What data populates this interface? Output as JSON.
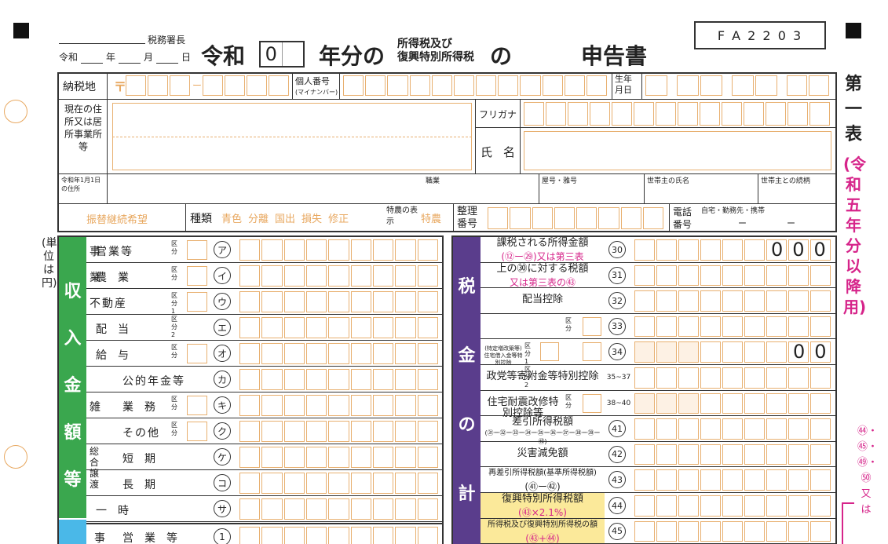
{
  "header": {
    "tax_office": "税務署長",
    "date_line": [
      "令和",
      "年",
      "月",
      "日"
    ],
    "title_reiwa": "令和",
    "year_value": "0",
    "year_suffix": "年分の",
    "tax_line1": "所得税及び",
    "tax_line2": "復興特別所得税",
    "no": "の",
    "title": "申告書",
    "form_code": "F A 2 2 0 3"
  },
  "side": {
    "table_no": "第一表",
    "period": "(令和五年分以降用)",
    "unit": "(単位は円)",
    "right_refs": "㊹・㊺・㊾・㊿又は"
  },
  "info": {
    "address_label": "納税地",
    "postal_mark": "〒",
    "mynumber_label": "個人番号",
    "mynumber_sub": "(マイナンバー)",
    "birth_label": "生年月日",
    "current_address_label": "現在の住所又は居所事業所等",
    "furigana_label": "フリガナ",
    "name_label": "氏名",
    "jan1_label": "令和年1月1日の住所",
    "occupation_label": "職業",
    "trade_name_label": "屋号・雅号",
    "householder_label": "世帯主の氏名",
    "householder_rel_label": "世帯主との続柄",
    "transfer_label": "振替継続希望",
    "type_label": "種類",
    "types": [
      "青色",
      "分離",
      "国出",
      "損失",
      "修正"
    ],
    "special_label": "特農の表示",
    "special_value": "特農",
    "ref_no_label": "整理番号",
    "phone_label": "電話番号",
    "phone_sub": "自宅・勤務先・携帯",
    "phone_dashes": [
      "ー",
      "ー"
    ]
  },
  "income": {
    "band_label": "収入金額等",
    "rows": [
      {
        "cat": "事",
        "item": "営業等",
        "kubun": "区分",
        "mark": "ア"
      },
      {
        "cat": "業",
        "item": "農業",
        "kubun": "区分",
        "mark": "イ"
      },
      {
        "cat": "",
        "item": "不動産",
        "kubun": "区分1 区分2",
        "mark": "ウ"
      },
      {
        "cat": "",
        "item": "配当",
        "kubun": "",
        "mark": "エ"
      },
      {
        "cat": "",
        "item": "給与",
        "kubun": "区分",
        "mark": "オ"
      },
      {
        "cat": "",
        "item": "公的年金等",
        "kubun": "",
        "mark": "カ"
      },
      {
        "cat": "雑",
        "item": "業務",
        "kubun": "区分",
        "mark": "キ"
      },
      {
        "cat": "",
        "item": "その他",
        "kubun": "区分",
        "mark": "ク"
      },
      {
        "cat": "総合譲渡",
        "item": "短期",
        "kubun": "",
        "mark": "ケ"
      },
      {
        "cat": "",
        "item": "長期",
        "kubun": "",
        "mark": "コ"
      },
      {
        "cat": "",
        "item": "一時",
        "kubun": "",
        "mark": "サ"
      }
    ],
    "bottom_row": {
      "cat": "事",
      "item": "営業等",
      "mark": "1"
    }
  },
  "tax": {
    "band_label": "税金の計",
    "rows": [
      {
        "l1": "課税される所得金額",
        "l2": "(⑫ー㉙)又は第三表",
        "mark": "30",
        "value": "000"
      },
      {
        "l1": "上の㉚に対する税額",
        "l2": "又は第三表の㊸",
        "mark": "31",
        "value": ""
      },
      {
        "l1": "配当控除",
        "l2": "",
        "mark": "32",
        "value": ""
      },
      {
        "l1": "",
        "l2": "区分",
        "mark": "33",
        "value": ""
      },
      {
        "l1": "(特定増改築等)住宅借入金等特別控除",
        "l2": "区分1 区分2",
        "mark": "34",
        "value": "00"
      },
      {
        "l1": "政党等寄附金等特別控除",
        "l2": "",
        "mark": "35~37",
        "value": ""
      },
      {
        "l1": "住宅耐震改修特別控除等",
        "l2": "区分",
        "mark": "38~40",
        "value": ""
      },
      {
        "l1": "差引所得税額",
        "l2": "(㉛ー㉜ー㉝ー㉞ー㉟ー㊱ー㊲ー㊳ー㊴ー㊵)",
        "mark": "41",
        "value": ""
      },
      {
        "l1": "災害減免額",
        "l2": "",
        "mark": "42",
        "value": ""
      },
      {
        "l1": "再差引所得税額(基準所得税額)",
        "l2": "(㊶ー㊷)",
        "mark": "43",
        "value": ""
      },
      {
        "l1": "復興特別所得税額",
        "l2": "(㊸×2.1%)",
        "mark": "44",
        "value": ""
      },
      {
        "l1": "所得税及び復興特別所得税の額",
        "l2": "(㊸+㊹)",
        "mark": "45",
        "value": ""
      }
    ]
  }
}
